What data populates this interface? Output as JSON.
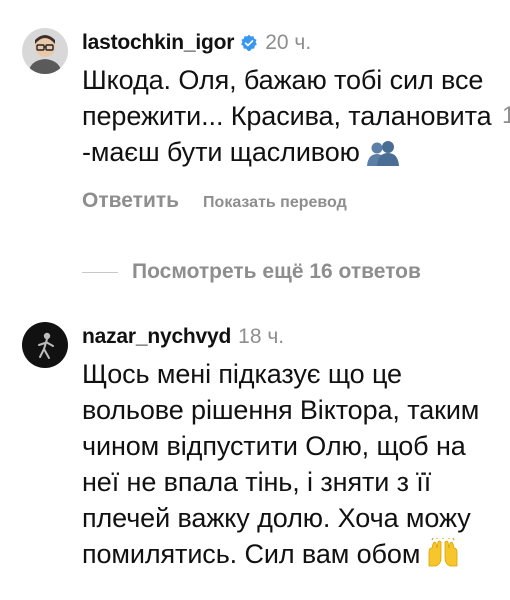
{
  "comments": [
    {
      "username": "lastochkin_igor",
      "verified": true,
      "time": "20 ч.",
      "text": "Шкода. Оля, бажаю тобі сил все пережити... Красива, талановита -маєш бути щасливою",
      "emoji": "couple-silhouette-icon",
      "reply_label": "Ответить",
      "translate_label": "Показать перевод",
      "avatar": "avatar-man-with-glasses",
      "edge_text": "1"
    },
    {
      "username": "nazar_nychvyd",
      "verified": false,
      "time": "18 ч.",
      "text": "Щось мені підказує що це вольове рішення Віктора, таким чином відпустити Олю, щоб на неї не впала тінь, і зняти з її плечей важку долю. Хоча можу помилятись. Сил вам обом",
      "emoji": "raised-hands-icon",
      "avatar": "avatar-dark-figure"
    }
  ],
  "more_replies_label": "Посмотреть ещё 16 ответов",
  "colors": {
    "text": "#111111",
    "muted": "#8e8e8e",
    "verified": "#3897f0",
    "divider": "#c7c7c7"
  }
}
